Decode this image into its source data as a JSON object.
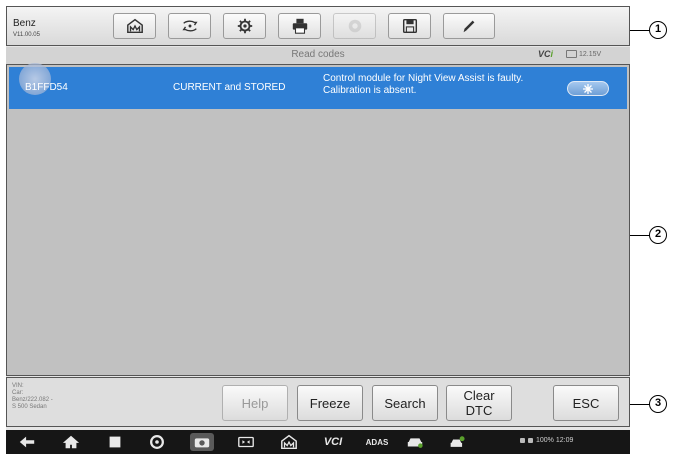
{
  "toolbar": {
    "vehicle_make": "Benz",
    "version": "V11.00.05",
    "buttons": [
      "home-icon",
      "vehicle-swap-icon",
      "settings-icon",
      "print-icon",
      "help-icon",
      "save-icon",
      "edit-icon"
    ]
  },
  "status": {
    "title": "Read codes",
    "vci_prefix": "VC",
    "vci_suffix": "i",
    "voltage": "12.15V"
  },
  "dtc_list": [
    {
      "code": "B1FFD54",
      "status": "CURRENT and STORED",
      "description": "Control module for Night View Assist is faulty. Calibration is absent.",
      "action_icon": "freeze-frame-snowflake-icon"
    }
  ],
  "vehicle_info": {
    "vin_label": "VIN:",
    "car_label": "Car:",
    "model": "Benz/222.082 -",
    "variant": "S 500 Sedan"
  },
  "function_buttons": {
    "help": "Help",
    "freeze": "Freeze",
    "search": "Search",
    "clear_line1": "Clear",
    "clear_line2": "DTC",
    "esc": "ESC"
  },
  "system_bar": {
    "vci": "VCI",
    "adas": "ADAS",
    "time": "100% 12:09"
  },
  "callouts": [
    "1",
    "2",
    "3"
  ],
  "colors": {
    "selected_row": "#2f80d6",
    "toolbar_bg": "#e6e6e6",
    "list_bg": "#c1c1c1",
    "navbar_bg": "#161616"
  }
}
